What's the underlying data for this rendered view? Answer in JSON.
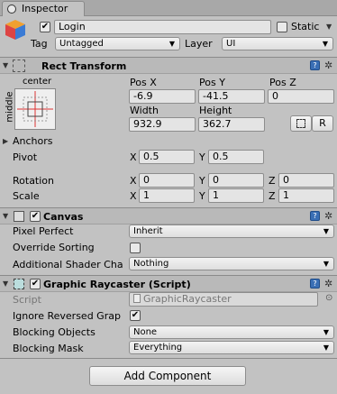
{
  "tab": {
    "title": "Inspector"
  },
  "gameobject": {
    "name": "Login",
    "static_label": "Static",
    "tag_label": "Tag",
    "tag_value": "Untagged",
    "layer_label": "Layer",
    "layer_value": "UI"
  },
  "rect_transform": {
    "title": "Rect Transform",
    "anchor_h": "center",
    "anchor_v": "middle",
    "pos_x_label": "Pos X",
    "pos_y_label": "Pos Y",
    "pos_z_label": "Pos Z",
    "pos_x": "-6.9",
    "pos_y": "-41.5",
    "pos_z": "0",
    "width_label": "Width",
    "height_label": "Height",
    "width": "932.9",
    "height": "362.7",
    "r_button": "R",
    "anchors_label": "Anchors",
    "pivot_label": "Pivot",
    "pivot_x": "0.5",
    "pivot_y": "0.5",
    "rotation_label": "Rotation",
    "rot_x": "0",
    "rot_y": "0",
    "rot_z": "0",
    "scale_label": "Scale",
    "scale_x": "1",
    "scale_y": "1",
    "scale_z": "1",
    "x": "X",
    "y": "Y",
    "z": "Z"
  },
  "canvas": {
    "title": "Canvas",
    "pixel_perfect_label": "Pixel Perfect",
    "pixel_perfect_value": "Inherit",
    "override_sorting_label": "Override Sorting",
    "shader_channels_label": "Additional Shader Cha",
    "shader_channels_value": "Nothing"
  },
  "raycaster": {
    "title": "Graphic Raycaster (Script)",
    "script_label": "Script",
    "script_value": "GraphicRaycaster",
    "ignore_reversed_label": "Ignore Reversed Grap",
    "blocking_objects_label": "Blocking Objects",
    "blocking_objects_value": "None",
    "blocking_mask_label": "Blocking Mask",
    "blocking_mask_value": "Everything"
  },
  "add_component": "Add Component",
  "colors": {
    "help_blue": "#3a6fb5",
    "cube_red": "#d44",
    "cube_orange": "#f0a030",
    "cube_blue": "#3a7bd5",
    "anchor_red": "#d33"
  }
}
